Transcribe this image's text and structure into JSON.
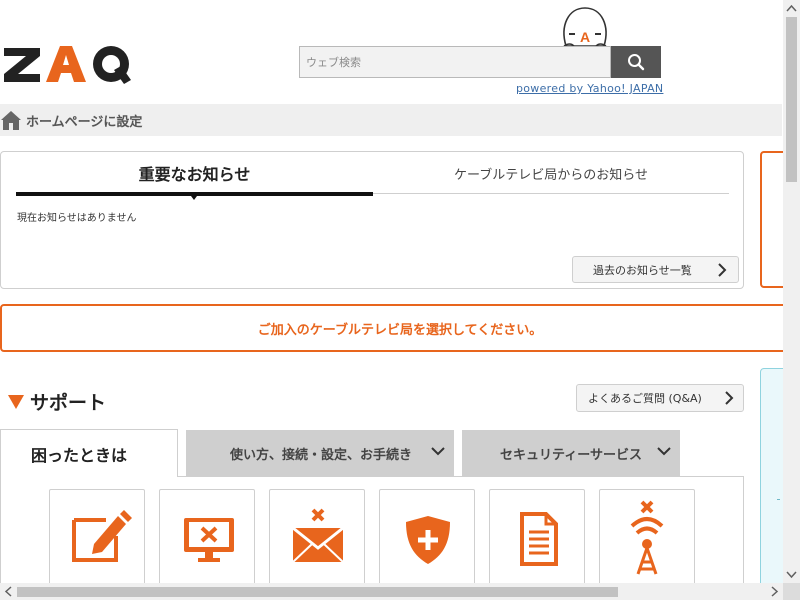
{
  "header": {
    "logo_text": "ZAQ",
    "mascot_badge": "A",
    "search": {
      "placeholder": "ウェブ検索",
      "value": ""
    },
    "powered_by": "powered by Yahoo! JAPAN"
  },
  "home_bar": {
    "label": "ホームページに設定"
  },
  "notices": {
    "tabs": [
      {
        "label": "重要なお知らせ",
        "active": true
      },
      {
        "label": "ケーブルテレビ局からのお知らせ",
        "active": false
      }
    ],
    "empty_message": "現在お知らせはありません",
    "past_button": "過去のお知らせ一覧"
  },
  "select_station": "ご加入のケーブルテレビ局を選択してください。",
  "support": {
    "title": "サポート",
    "faq_button": "よくあるご質問 (Q&A)",
    "tabs": [
      {
        "label": "困ったときは",
        "active": true
      },
      {
        "label": "使い方、接続・設定、お手続き",
        "active": false
      },
      {
        "label": "セキュリティーサービス",
        "active": false
      }
    ],
    "tiles": [
      {
        "icon": "edit-pencil-icon"
      },
      {
        "icon": "monitor-error-icon"
      },
      {
        "icon": "mail-error-icon"
      },
      {
        "icon": "security-shield-icon"
      },
      {
        "icon": "document-icon"
      },
      {
        "icon": "signal-error-icon"
      }
    ]
  },
  "colors": {
    "accent_orange": "#e8651d",
    "logo_dark": "#222222",
    "tab_inactive": "#cfcfcf",
    "link_blue": "#3d6ea8",
    "teal_panel": "#eaf8fb"
  }
}
